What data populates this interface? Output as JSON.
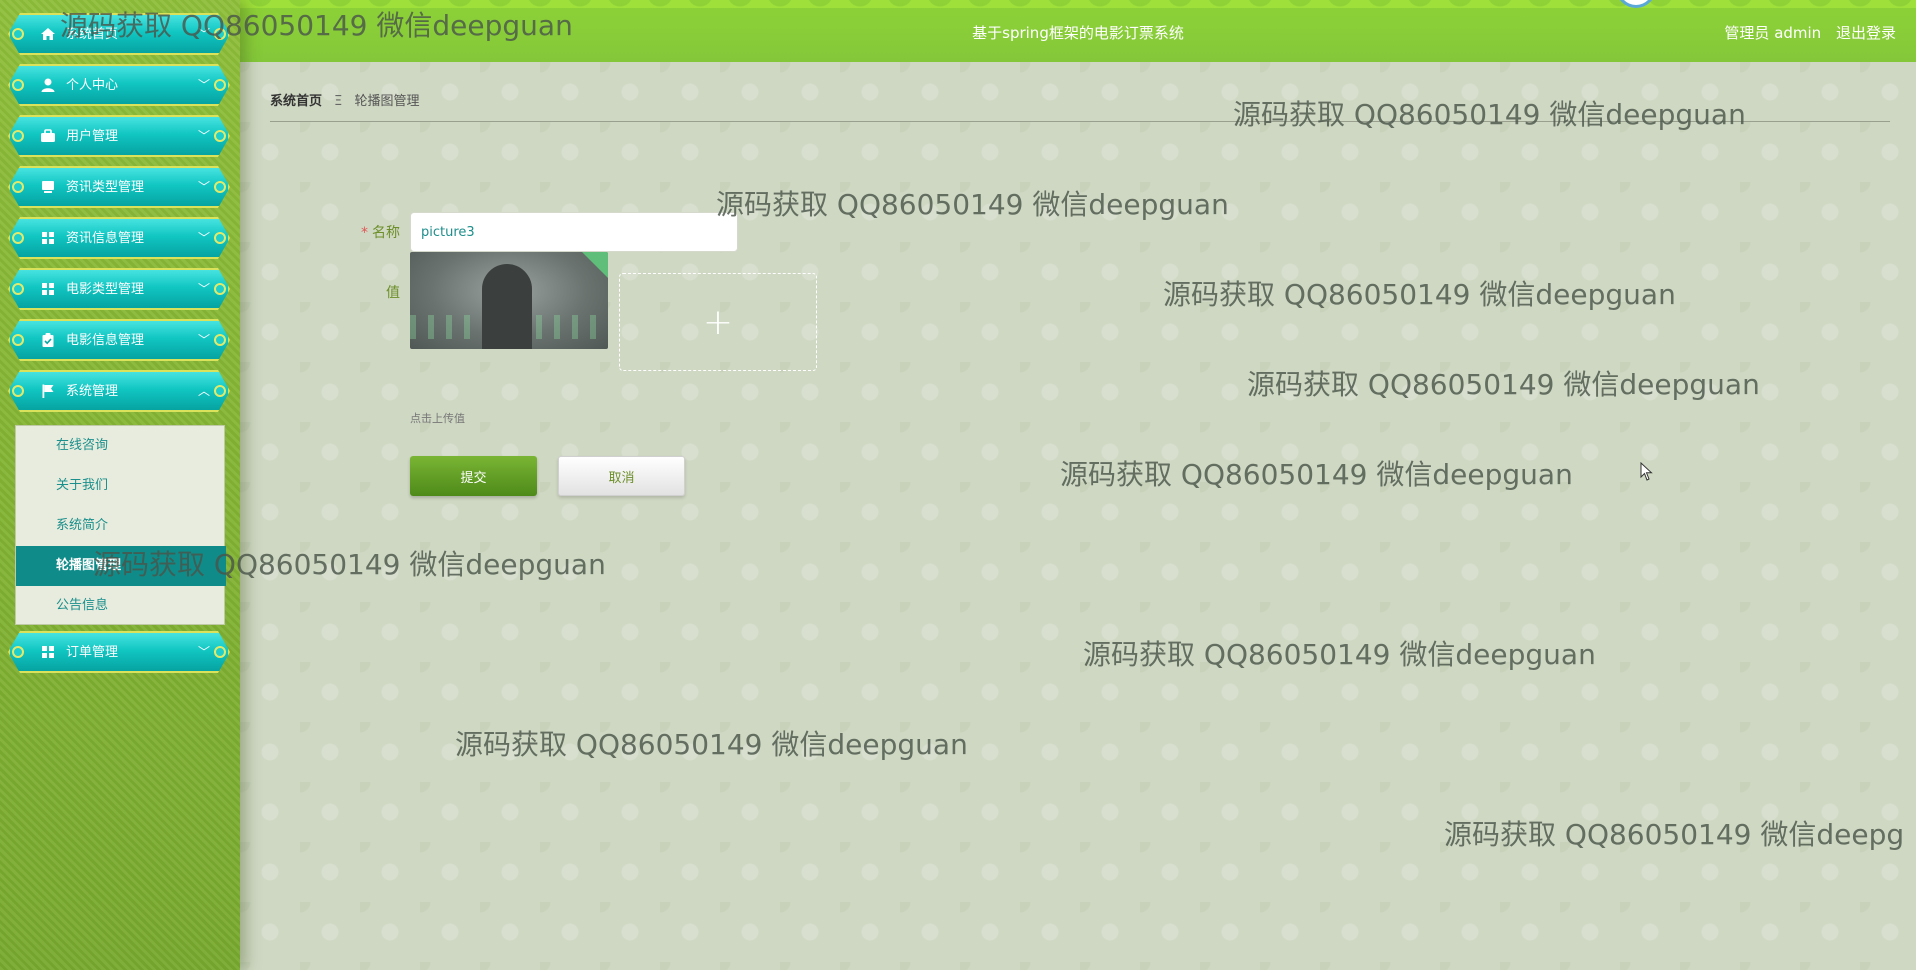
{
  "header": {
    "title": "基于spring框架的电影订票系统",
    "user_label": "管理员 admin",
    "logout_label": "退出登录"
  },
  "sidebar": {
    "items": [
      {
        "label": "系统首页",
        "icon": "home-icon"
      },
      {
        "label": "个人中心",
        "icon": "user-icon"
      },
      {
        "label": "用户管理",
        "icon": "briefcase-icon"
      },
      {
        "label": "资讯类型管理",
        "icon": "monitor-icon"
      },
      {
        "label": "资讯信息管理",
        "icon": "grid-icon"
      },
      {
        "label": "电影类型管理",
        "icon": "grid-icon"
      },
      {
        "label": "电影信息管理",
        "icon": "clipboard-icon"
      },
      {
        "label": "系统管理",
        "icon": "flag-icon"
      },
      {
        "label": "订单管理",
        "icon": "grid-icon"
      }
    ],
    "submenu": [
      {
        "label": "在线咨询"
      },
      {
        "label": "关于我们"
      },
      {
        "label": "系统简介"
      },
      {
        "label": "轮播图管理",
        "active": true
      },
      {
        "label": "公告信息"
      }
    ]
  },
  "breadcrumb": {
    "home": "系统首页",
    "separator": "Ξ",
    "current": "轮播图管理"
  },
  "form": {
    "name_label": "名称",
    "name_required_mark": "*",
    "name_value": "picture3",
    "value_label": "值",
    "upload_plus": "+",
    "upload_hint": "点击上传值",
    "submit_label": "提交",
    "cancel_label": "取消"
  },
  "watermark": {
    "text": "源码获取 QQ86050149 微信deepguan",
    "text_cut": "源码获取 QQ86050149 微信deepg"
  },
  "colors": {
    "header_green": "#8ed237",
    "menu_teal": "#11c6c2",
    "submit_green": "#5f9f24",
    "label_green": "#6d8f2a"
  }
}
